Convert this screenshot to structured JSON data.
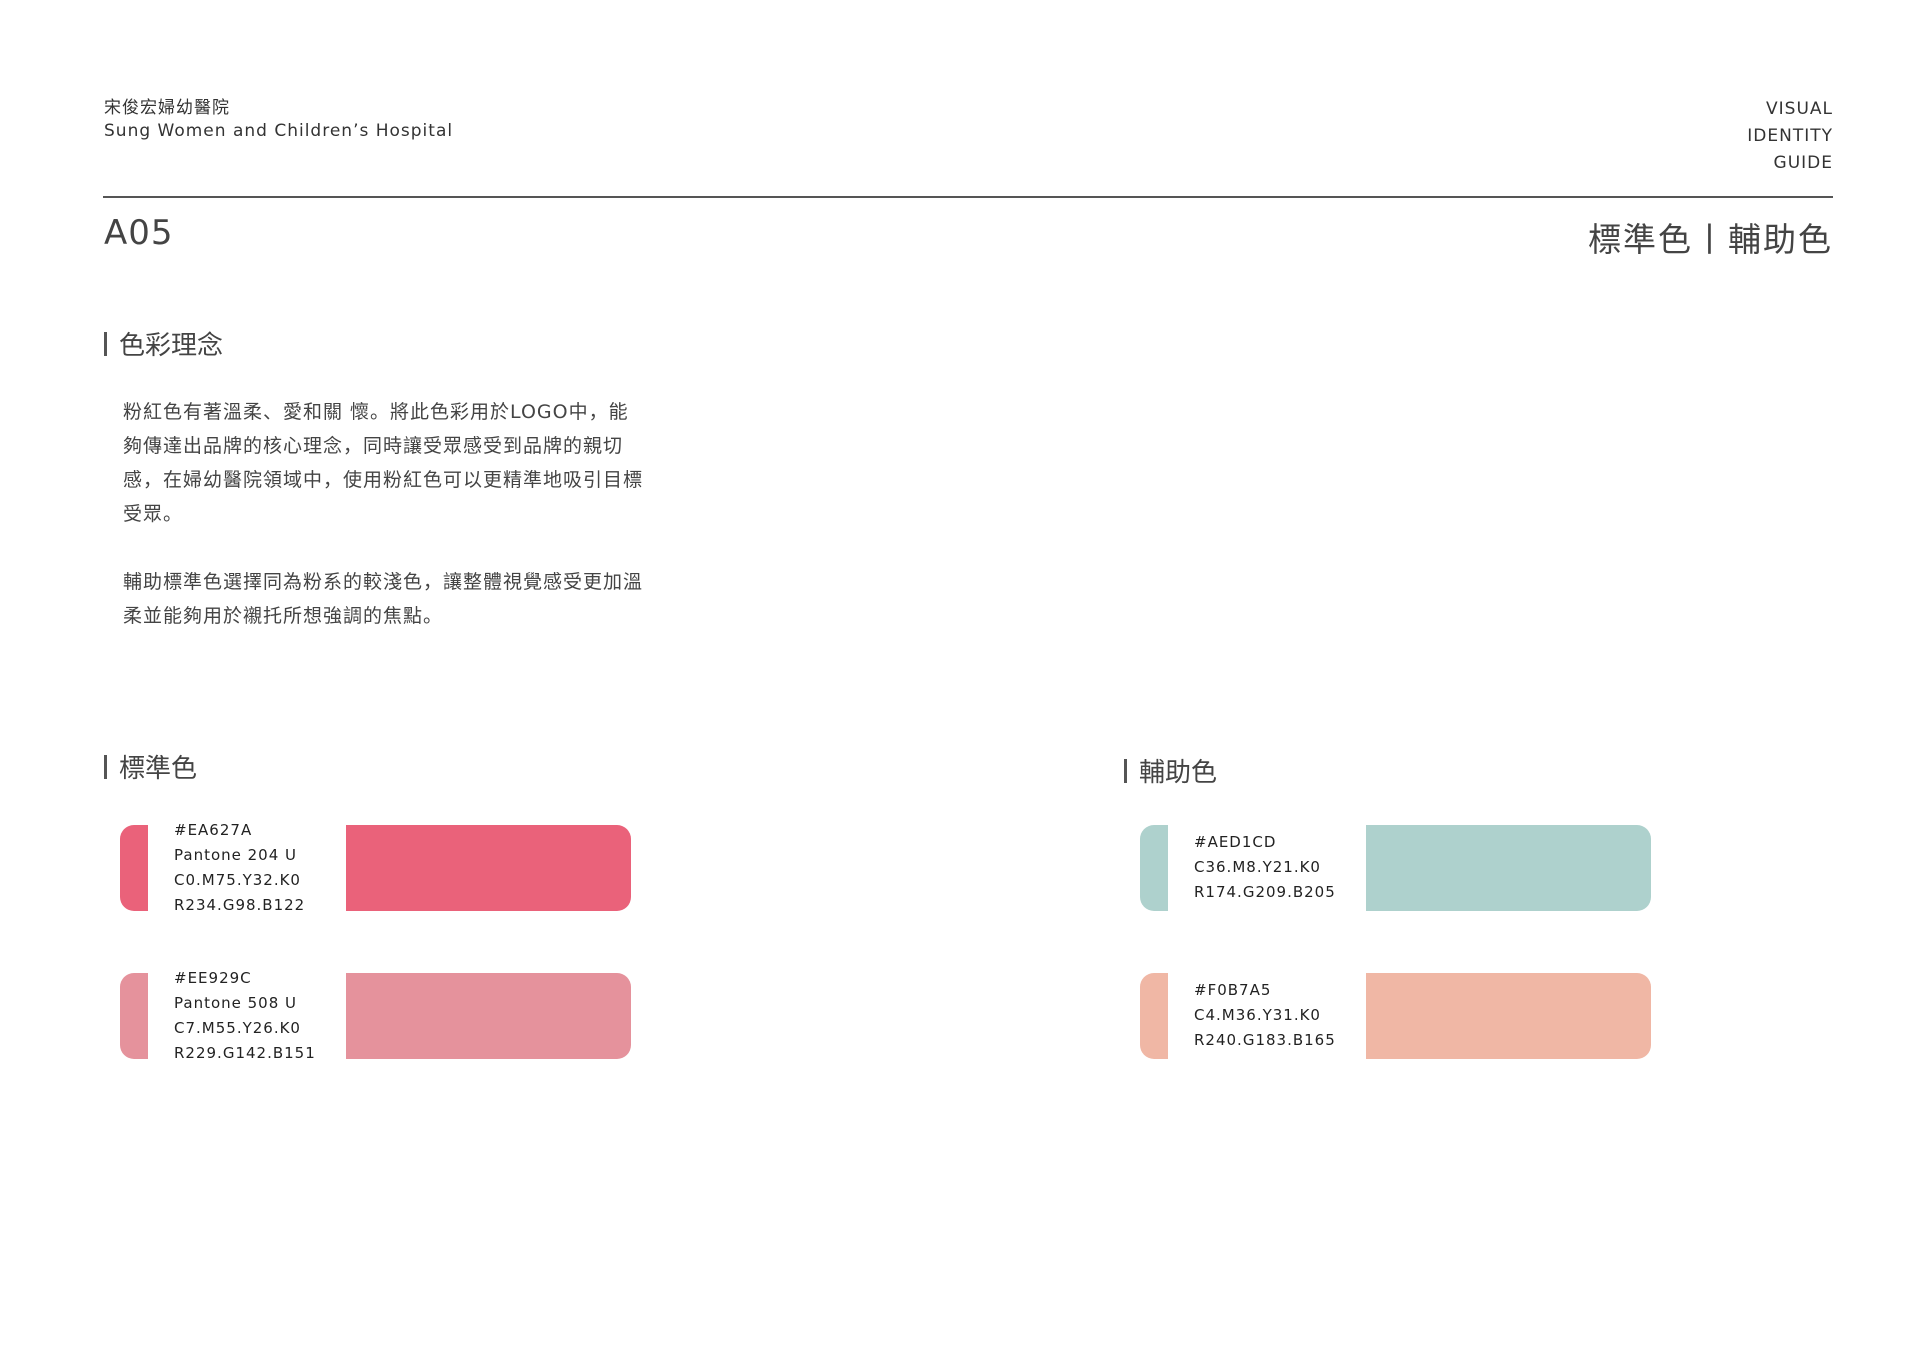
{
  "header": {
    "brand_cn": "宋俊宏婦幼醫院",
    "brand_en": "Sung Women and Children’s Hospital",
    "guide_lines": [
      "VISUAL",
      "IDENTITY",
      "GUIDE"
    ],
    "code": "A05",
    "page_title": "標準色丨輔助色"
  },
  "concept": {
    "heading": "色彩理念",
    "paragraph1": " 粉紅色有著溫柔、愛和關 懷。將此色彩用於LOGO中，能夠傳達出品牌的核心理念，同時讓受眾感受到品牌的親切感，在婦幼醫院領域中，使用粉紅色可以更精準地吸引目標受眾。",
    "paragraph2": "輔助標準色選擇同為粉系的較淺色，讓整體視覺感受更加溫柔並能夠用於襯托所想強調的焦點。"
  },
  "standard": {
    "heading": "標準色",
    "colors": [
      {
        "color": "#EA627A",
        "lines": [
          "#EA627A",
          "Pantone 204 U",
          "C0.M75.Y32.K0",
          "R234.G98.B122"
        ]
      },
      {
        "color": "#E5929C",
        "lines": [
          "#EE929C",
          "Pantone 508 U",
          "C7.M55.Y26.K0",
          "R229.G142.B151"
        ]
      }
    ]
  },
  "auxiliary": {
    "heading": "輔助色",
    "colors": [
      {
        "color": "#AED1CD",
        "lines": [
          "#AED1CD",
          "C36.M8.Y21.K0",
          "R174.G209.B205"
        ]
      },
      {
        "color": "#F0B7A5",
        "lines": [
          "#F0B7A5",
          "C4.M36.Y31.K0",
          "R240.G183.B165"
        ]
      }
    ]
  }
}
